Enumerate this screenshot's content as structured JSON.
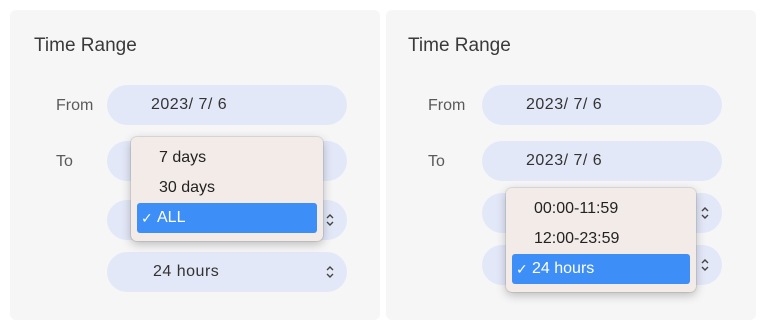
{
  "left": {
    "title": "Time Range",
    "from_label": "From",
    "from_value": "2023/  7/  6",
    "to_label": "To",
    "hours_value": "24 hours",
    "menu": {
      "items": [
        "7 days",
        "30 days",
        "ALL"
      ],
      "selected_index": 2
    }
  },
  "right": {
    "title": "Time Range",
    "from_label": "From",
    "from_value": "2023/  7/  6",
    "to_label": "To",
    "to_value": "2023/  7/  6",
    "menu": {
      "items": [
        "00:00-11:59",
        "12:00-23:59",
        "24 hours"
      ],
      "selected_index": 2
    }
  },
  "check_glyph": "✓",
  "icons": {
    "select_arrows": "chevron-up-down-icon"
  },
  "colors": {
    "panel_bg": "#f6f6f7",
    "pill_bg": "#e3e8f8",
    "menu_bg": "#f3ebe8",
    "selected_bg": "#3d8ef6"
  }
}
